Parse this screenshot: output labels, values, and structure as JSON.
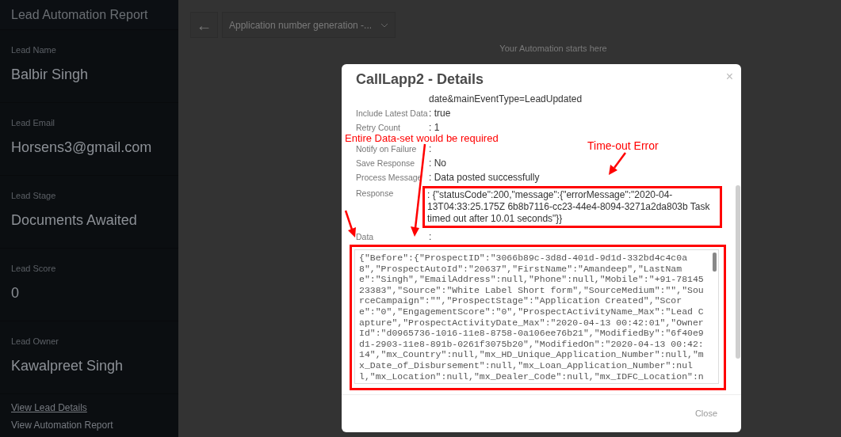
{
  "sidebar": {
    "title": "Lead Automation Report",
    "fields": [
      {
        "label": "Lead Name",
        "value": "Balbir Singh"
      },
      {
        "label": "Lead Email",
        "value": "Horsens3@gmail.com"
      },
      {
        "label": "Lead Stage",
        "value": "Documents Awaited"
      },
      {
        "label": "Lead Score",
        "value": "0"
      },
      {
        "label": "Lead Owner",
        "value": "Kawalpreet Singh"
      }
    ],
    "links": [
      "View Lead Details",
      "View Automation Report"
    ]
  },
  "toolbar": {
    "back": "←",
    "dropdown": "Application number generation -..."
  },
  "canvas_hint": "Your Automation starts here",
  "dialog": {
    "title": "CallLapp2 - Details",
    "close": "×",
    "rows": [
      {
        "value": "date&mainEventType=LeadUpdated"
      },
      {
        "label": "Include Latest Data",
        "value": ": true"
      },
      {
        "label": "Retry Count",
        "value": ": 1"
      },
      {
        "label": "Notify on Failure",
        "value": ":"
      },
      {
        "label": "Save Response",
        "value": ": No"
      },
      {
        "label": "Process Message",
        "value": ": Data posted successfully"
      },
      {
        "label": "Response",
        "value": ": {\"statusCode\":200,\"message\":{\"errorMessage\":\"2020-04-13T04:33:25.175Z 6b8b7116-cc23-44e4-8094-3271a2da803b Task timed out after 10.01 seconds\"}}",
        "highlighted": true
      },
      {
        "label": "Data",
        "value": ":"
      }
    ],
    "data_lines": [
      "{\"Before\":{\"ProspectID\":\"3066b89c-3d8d-401d-9d1d-332bd4c4c0a",
      "8\",\"ProspectAutoId\":\"20637\",\"FirstName\":\"Amandeep\",\"LastNam",
      "e\":\"Singh\",\"EmailAddress\":null,\"Phone\":null,\"Mobile\":\"+91-78145",
      "23383\",\"Source\":\"White Label Short form\",\"SourceMedium\":\"\",\"Sou",
      "rceCampaign\":\"\",\"ProspectStage\":\"Application Created\",\"Scor",
      "e\":\"0\",\"EngagementScore\":\"0\",\"ProspectActivityName_Max\":\"Lead C",
      "apture\",\"ProspectActivityDate_Max\":\"2020-04-13 00:42:01\",\"Owner",
      "Id\":\"d0965736-1016-11e8-8758-0a106ee76b21\",\"ModifiedBy\":\"6f40e9",
      "d1-2903-11e8-891b-0261f3075b20\",\"ModifiedOn\":\"2020-04-13 00:42:",
      "14\",\"mx_Country\":null,\"mx_HD_Unique_Application_Number\":null,\"m",
      "x_Date_of_Disbursement\":null,\"mx_Loan_Application_Number\":nul",
      "l,\"mx_Location\":null,\"mx_Dealer_Code\":null,\"mx_IDFC_Location\":n"
    ],
    "data_highlighted": true,
    "footer_button": "Close"
  },
  "annotations": [
    {
      "text": "Entire Data-set would be required"
    },
    {
      "text": "Time-out Error"
    }
  ]
}
